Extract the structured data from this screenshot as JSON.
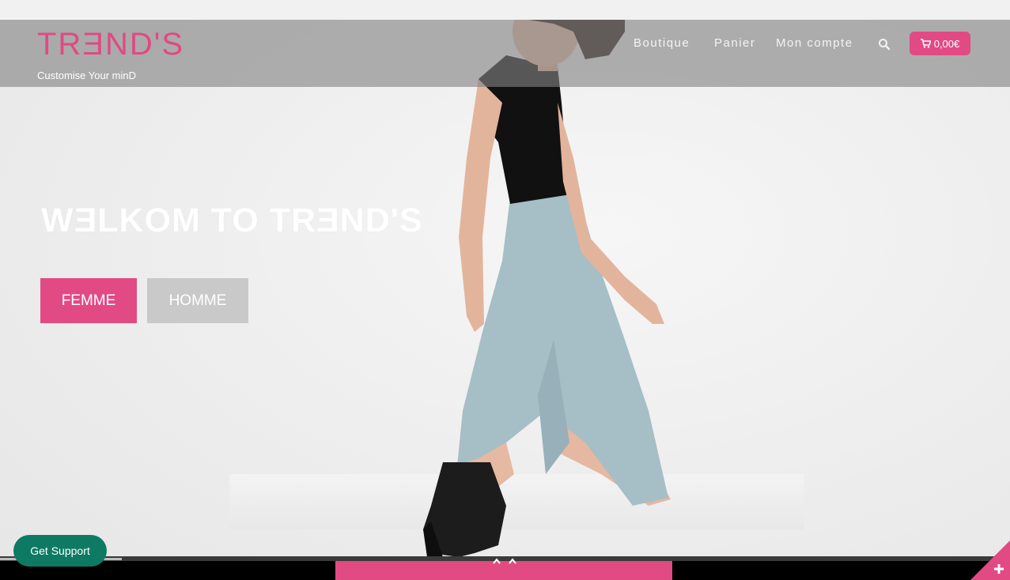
{
  "brand": {
    "logo": "TRƎND'S",
    "tagline": "Customise Your minD"
  },
  "nav": {
    "items": [
      "Boutique",
      "Panier",
      "Mon compte"
    ],
    "search_icon": "search-icon"
  },
  "cart": {
    "icon": "cart-icon",
    "amount": "0,00€"
  },
  "hero": {
    "title": "WƎLKOM TO TRƎND'S",
    "buttons": [
      "FEMME",
      "HOMME"
    ]
  },
  "support": {
    "label": "Get Support"
  },
  "colors": {
    "accent": "#e24a84",
    "support": "#0e7a63",
    "header_overlay": "#828282"
  },
  "icons": {
    "scroll_up": "chevron-up-icon",
    "corner_toggle": "plus-icon"
  }
}
